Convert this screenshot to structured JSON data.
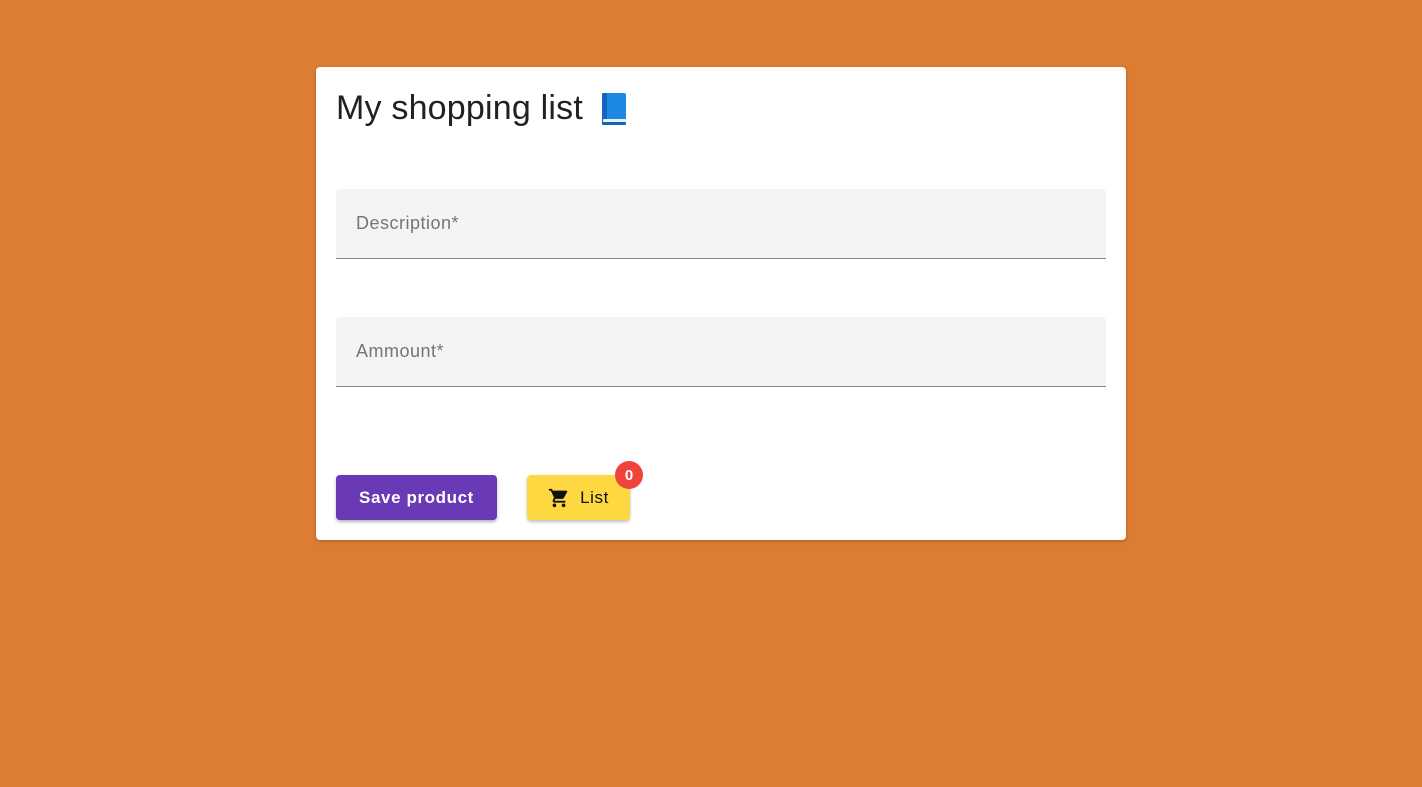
{
  "page": {
    "background_color": "#dd7d33"
  },
  "card": {
    "title": "My shopping list",
    "title_icon": "book-icon"
  },
  "form": {
    "description": {
      "value": "",
      "placeholder": "Description*"
    },
    "amount": {
      "value": "",
      "placeholder": "Ammount*"
    }
  },
  "actions": {
    "save_label": "Save product",
    "save_color": "#6a39b5",
    "list_label": "List",
    "list_icon": "shopping-cart-icon",
    "list_color": "#fdd841",
    "list_badge_count": "0",
    "badge_color": "#f0433a"
  }
}
